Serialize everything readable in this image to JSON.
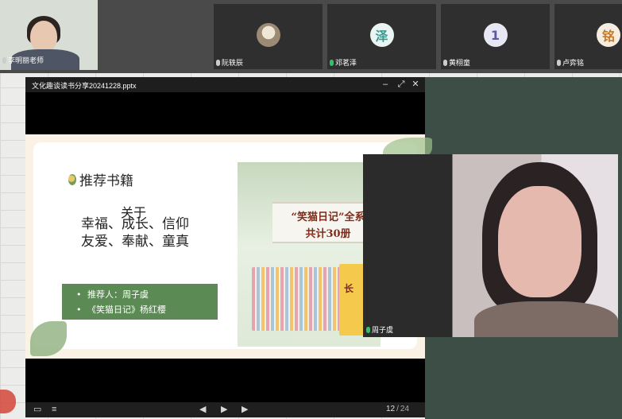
{
  "participants": [
    {
      "name": "李明丽老师",
      "avatar": "",
      "avatar_bg": "",
      "mic_on": false
    },
    {
      "name": "阮轶辰",
      "avatar": "",
      "avatar_bg": "",
      "mic_on": false
    },
    {
      "name": "邓茗泽",
      "avatar": "泽",
      "avatar_bg": "#e9f4f3",
      "mic_on": true
    },
    {
      "name": "黄栩童",
      "avatar": "1",
      "avatar_bg": "#e8e8f4",
      "mic_on": false
    },
    {
      "name": "卢弈铭",
      "avatar": "铭",
      "avatar_bg": "#f6ece0",
      "mic_on": false
    }
  ],
  "presentation": {
    "window_title": "文化趣谈读书分享20241228.pptx",
    "slide": {
      "heading": "推荐书籍",
      "about": "关于",
      "themes_line1": "幸福、成长、信仰",
      "themes_line2": "友爱、奉献、童真",
      "bullet1": "推荐人：周子虞",
      "bullet2": "《笑猫日记》杨红樱",
      "image_banner1": "“笑猫日记”全系",
      "image_banner2": "共计30册",
      "image_cover_text": "长"
    },
    "current_page": "12",
    "total_pages": "24"
  },
  "student_video": {
    "name": "周子虞",
    "mic_on": true
  },
  "colors": {
    "accent_green": "#5c8a55",
    "mic_active": "#2ec26b"
  },
  "icons": [
    "minimize-icon",
    "restore-icon",
    "close-icon",
    "sidebar-icon",
    "menu-icon",
    "prev-icon",
    "play-icon",
    "next-icon",
    "mic-icon",
    "camera-photo"
  ]
}
